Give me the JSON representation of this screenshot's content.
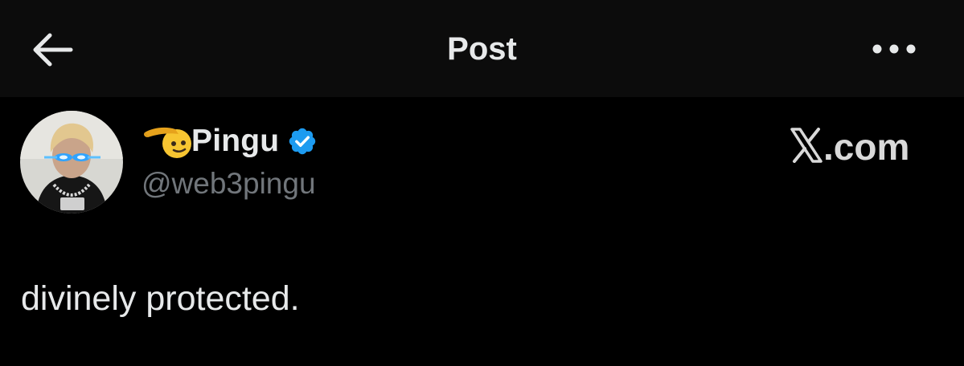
{
  "header": {
    "title": "Post",
    "back_icon": "arrow-left-icon",
    "more_icon": "more-horizontal-icon",
    "background": "#0c0c0c"
  },
  "author": {
    "display_name": "Pingu",
    "handle": "@web3pingu",
    "name_emoji": "saluting-face-emoji",
    "verified_badge": "verified-badge-icon",
    "verified_color": "#1d9bf0",
    "avatar": "profile-avatar"
  },
  "watermark": {
    "text": ".com",
    "logo": "x-logo-icon"
  },
  "post": {
    "text": "divinely protected."
  },
  "colors": {
    "background": "#000000",
    "primary_text": "#e7e9ea",
    "secondary_text": "#71767b"
  }
}
